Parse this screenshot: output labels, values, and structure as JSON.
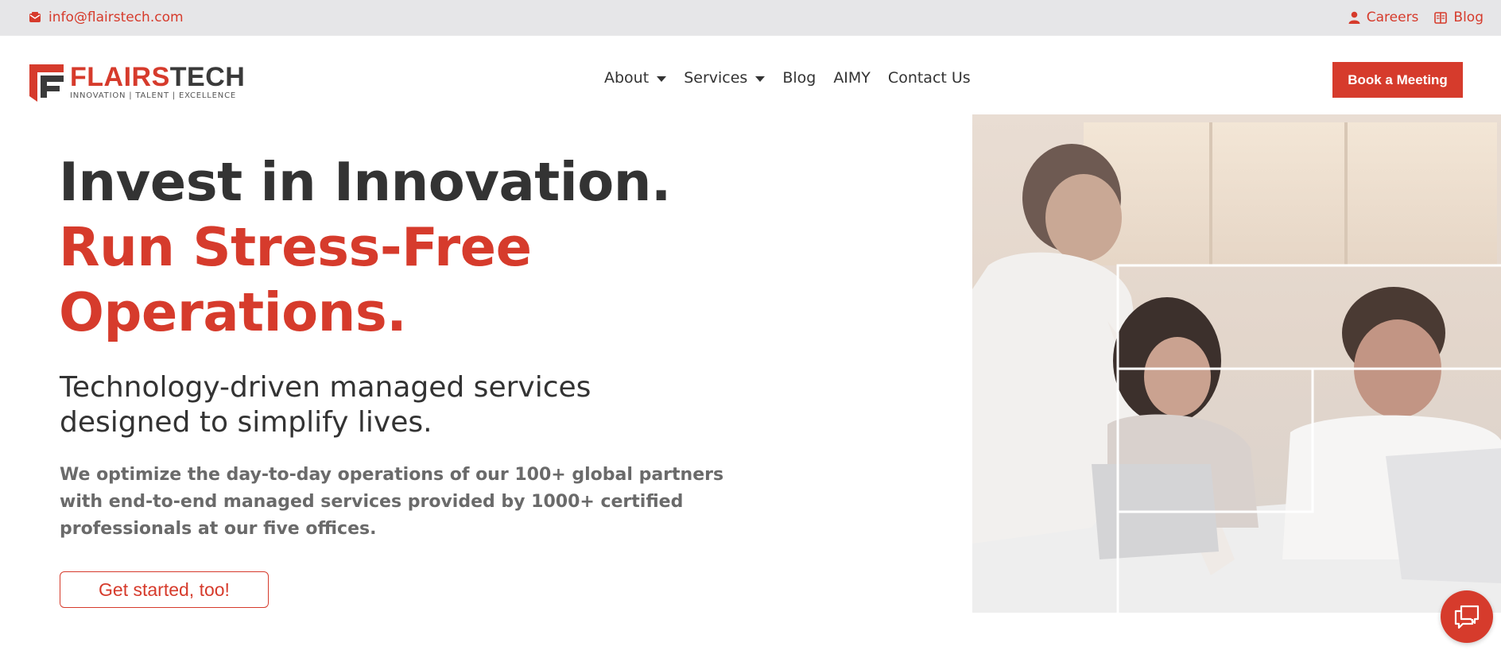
{
  "topbar": {
    "email": "info@flairstech.com",
    "email_icon": "envelope-icon",
    "links": [
      {
        "label": "Careers",
        "icon": "user-icon"
      },
      {
        "label": "Blog",
        "icon": "book-icon"
      }
    ]
  },
  "logo": {
    "name_red": "FLAIRS",
    "name_dark": "TECH",
    "tagline": "INNOVATION | TALENT | EXCELLENCE"
  },
  "nav": {
    "items": [
      {
        "label": "About",
        "has_dropdown": true
      },
      {
        "label": "Services",
        "has_dropdown": true
      },
      {
        "label": "Blog",
        "has_dropdown": false
      },
      {
        "label": "AIMY",
        "has_dropdown": false
      },
      {
        "label": "Contact Us",
        "has_dropdown": false
      }
    ]
  },
  "header": {
    "book_button": "Book a Meeting"
  },
  "hero": {
    "headline_dark": "Invest in Innovation.",
    "headline_red_1": "Run Stress-Free",
    "headline_red_2": "Operations.",
    "subheading_1": "Technology-driven managed services",
    "subheading_2": "designed to simplify lives.",
    "description": "We optimize the day-to-day operations of our 100+ global partners with end-to-end managed services provided by 1000+ certified professionals at our five offices.",
    "cta_label": "Get started, too!",
    "image": "team-working-photo"
  },
  "chat": {
    "icon": "chat-bubble-icon"
  },
  "colors": {
    "brand_red": "#d63b2c",
    "text_dark": "#333333",
    "text_grey": "#6a6a6a",
    "topbar_bg": "#e6e6e8"
  }
}
